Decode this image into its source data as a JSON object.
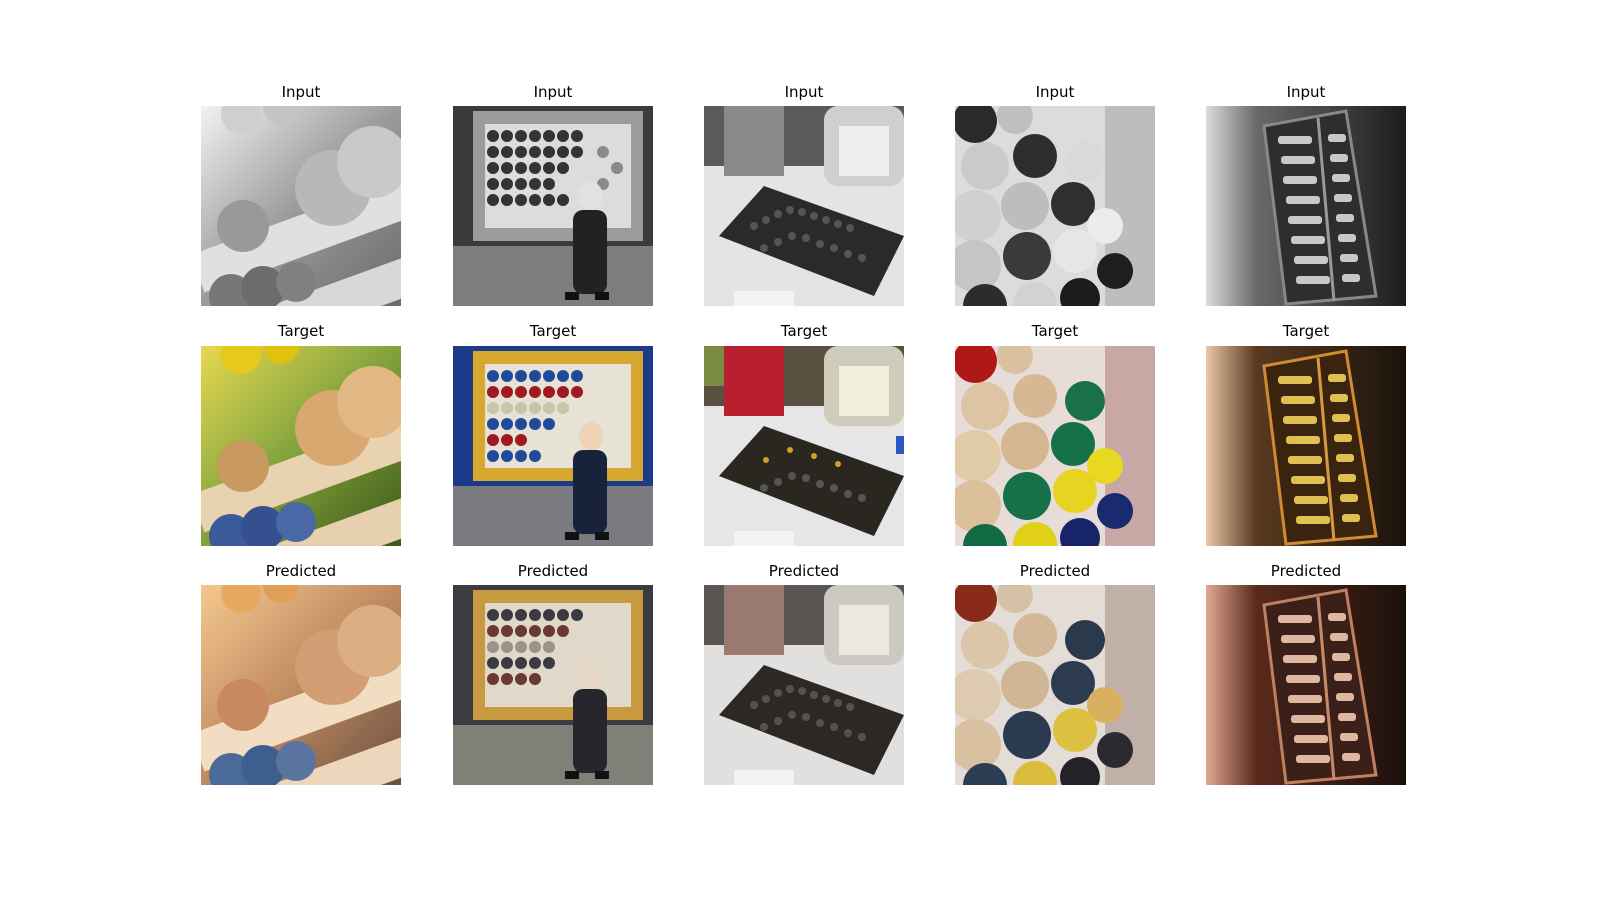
{
  "rows": [
    {
      "label": "Input"
    },
    {
      "label": "Target"
    },
    {
      "label": "Predicted"
    }
  ],
  "columns": [
    {
      "subject": "abacus close-up"
    },
    {
      "subject": "child at playground abacus"
    },
    {
      "subject": "desk abacus with jar"
    },
    {
      "subject": "diagonal abacus beads"
    },
    {
      "subject": "hand holding small abacus"
    }
  ]
}
